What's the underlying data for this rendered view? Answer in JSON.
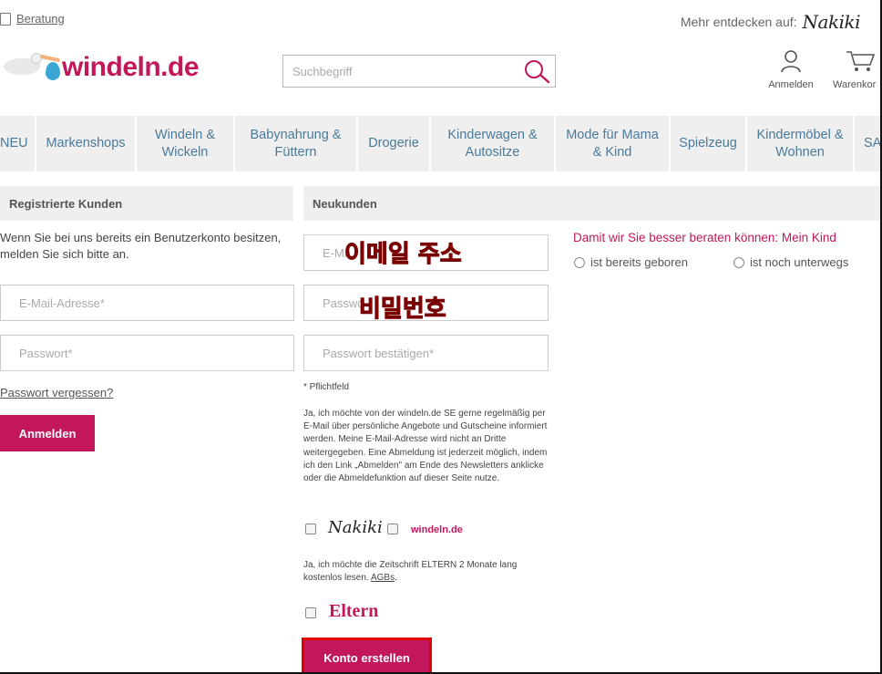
{
  "topbar": {
    "beratung": "Beratung",
    "mehr": "Mehr entdecken auf:",
    "nakiki": "Nakiki"
  },
  "logo": {
    "text": "windeln.de"
  },
  "search": {
    "placeholder": "Suchbegriff"
  },
  "header_icons": {
    "login": "Anmelden",
    "cart": "Warenkor"
  },
  "nav": [
    "NEU",
    "Markenshops",
    "Windeln & Wickeln",
    "Babynahrung & Füttern",
    "Drogerie",
    "Kinderwagen & Autositze",
    "Mode für Mama & Kind",
    "Spielzeug",
    "Kindermöbel & Wohnen",
    "SA"
  ],
  "registered": {
    "heading": "Registrierte Kunden",
    "intro": "Wenn Sie bei uns bereits ein Benutzerkonto besitzen, melden Sie sich bitte an.",
    "email_placeholder": "E-Mail-Adresse*",
    "password_placeholder": "Passwort*",
    "forgot": "Passwort vergessen?",
    "login_button": "Anmelden"
  },
  "new_customers": {
    "heading": "Neukunden",
    "email_placeholder": "E-Ma",
    "password_placeholder": "Passwo",
    "password_confirm_placeholder": "Passwort bestätigen*",
    "required_note": "* Pflichtfeld",
    "newsletter_text": "Ja, ich möchte von der windeln.de SE gerne regelmäßig per E-Mail über persönliche Angebote und Gutscheine informiert werden. Meine E-Mail-Adresse wird nicht an Dritte weitergegeben. Eine Abmeldung ist jederzeit möglich, indem ich den Link „Abmelden\" am Ende des Newsletters anklicke oder die Abmeldefunktion auf dieser Seite nutze.",
    "brand_nakiki": "Nakiki",
    "brand_windeln": "windeln.de",
    "eltern_text": "Ja, ich möchte die Zeitschrift ELTERN 2 Monate lang kostenlos lesen.",
    "agbs": "AGBs",
    "eltern_brand": "Eltern",
    "create_button": "Konto erstellen"
  },
  "kind": {
    "title": "Damit wir Sie besser beraten können: Mein Kind",
    "option_born": "ist bereits geboren",
    "option_expecting": "ist noch unterwegs"
  },
  "overlays": {
    "email_ko": "이메일 주소",
    "password_ko": "비밀번호"
  },
  "colors": {
    "brand": "#c2185b",
    "nav_text": "#4a7a9a",
    "overlay_red": "#e00000"
  }
}
